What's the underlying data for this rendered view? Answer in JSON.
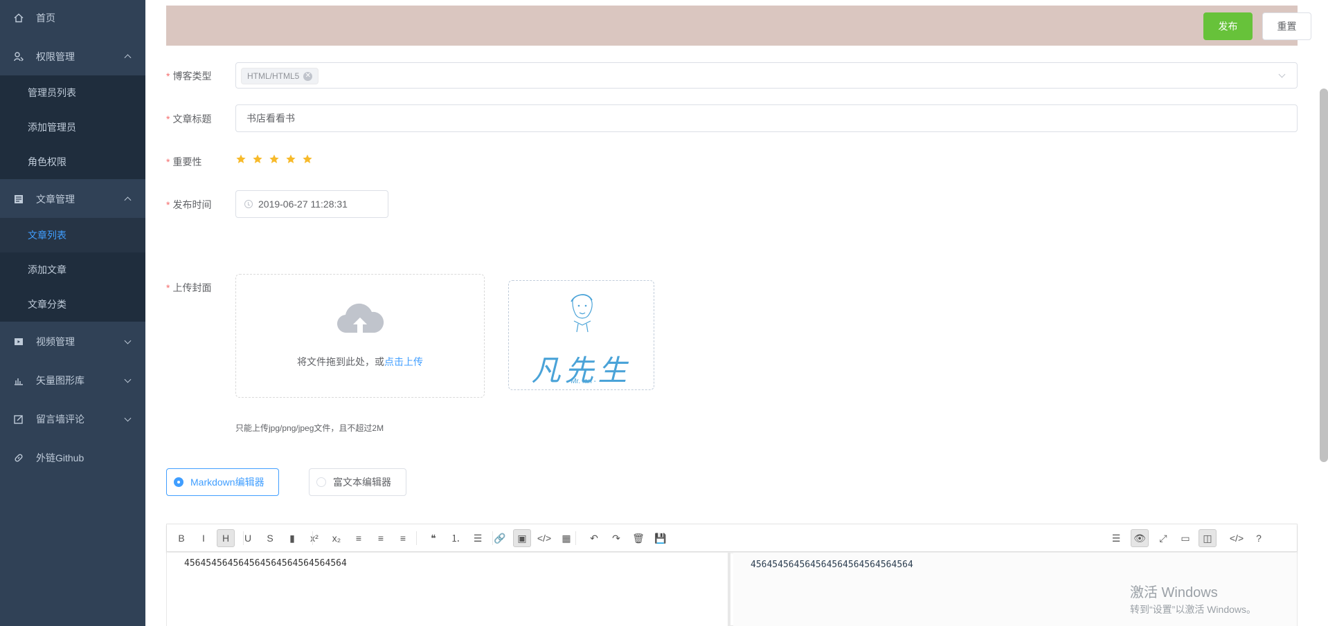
{
  "sidebar": {
    "items": [
      {
        "label": "首页",
        "icon": "home-icon"
      },
      {
        "label": "权限管理",
        "icon": "permission-icon",
        "expanded": true,
        "children": [
          {
            "label": "管理员列表"
          },
          {
            "label": "添加管理员"
          },
          {
            "label": "角色权限"
          }
        ]
      },
      {
        "label": "文章管理",
        "icon": "article-icon",
        "expanded": true,
        "children": [
          {
            "label": "文章列表",
            "active": true
          },
          {
            "label": "添加文章"
          },
          {
            "label": "文章分类"
          }
        ]
      },
      {
        "label": "视频管理",
        "icon": "video-icon",
        "expanded": false
      },
      {
        "label": "矢量图形库",
        "icon": "chart-icon",
        "expanded": false
      },
      {
        "label": "留言墙评论",
        "icon": "edit-icon",
        "expanded": false
      },
      {
        "label": "外链Github",
        "icon": "link-icon"
      }
    ]
  },
  "topbar": {
    "publish_label": "发布",
    "reset_label": "重置"
  },
  "form": {
    "blog_type": {
      "label": "博客类型",
      "tag": "HTML/HTML5"
    },
    "title": {
      "label": "文章标题",
      "value": "书店看看书"
    },
    "importance": {
      "label": "重要性",
      "rating": 5,
      "max": 5
    },
    "publish_time": {
      "label": "发布时间",
      "value": "2019-06-27 11:28:31"
    },
    "cover": {
      "label": "上传封面",
      "drop_text": "将文件拖到此处，或",
      "drop_link": "点击上传",
      "tip": "只能上传jpg/png/jpeg文件，且不超过2M",
      "preview_text": "凡先生",
      "preview_sub": "- Mr. fan -"
    },
    "editor_mode": {
      "markdown": "Markdown编辑器",
      "rich": "富文本编辑器",
      "selected": "markdown"
    }
  },
  "editor": {
    "content": "456454564564564564564564564564",
    "preview": "456454564564564564564564564564",
    "left_tools": [
      {
        "icon": "bold-icon",
        "glyph": "B"
      },
      {
        "icon": "italic-icon",
        "glyph": "I"
      },
      {
        "icon": "heading-icon",
        "glyph": "H",
        "on": true
      },
      {
        "icon": "underline-icon",
        "glyph": "U"
      },
      {
        "icon": "strikethrough-icon",
        "glyph": "S"
      },
      {
        "icon": "bookmark-icon",
        "glyph": "▮"
      },
      {
        "icon": "superscript-icon",
        "glyph": "x²"
      },
      {
        "icon": "subscript-icon",
        "glyph": "x₂"
      },
      {
        "icon": "align-left-icon",
        "glyph": "≡"
      },
      {
        "icon": "align-center-icon",
        "glyph": "≡"
      },
      {
        "icon": "align-right-icon",
        "glyph": "≡"
      },
      {
        "icon": "quote-icon",
        "glyph": "❝"
      },
      {
        "icon": "ordered-list-icon",
        "glyph": "⒈"
      },
      {
        "icon": "unordered-list-icon",
        "glyph": "☰"
      },
      {
        "icon": "link-icon",
        "glyph": "🔗"
      },
      {
        "icon": "image-icon",
        "glyph": "▣",
        "on": true
      },
      {
        "icon": "code-icon",
        "glyph": "</>"
      },
      {
        "icon": "table-icon",
        "glyph": "▦"
      },
      {
        "icon": "undo-icon",
        "glyph": "↶"
      },
      {
        "icon": "redo-icon",
        "glyph": "↷"
      },
      {
        "icon": "trash-icon",
        "glyph": "🗑"
      },
      {
        "icon": "save-icon",
        "glyph": "💾"
      }
    ],
    "right_tools": [
      {
        "icon": "navigation-icon",
        "glyph": "☰"
      },
      {
        "icon": "preview-toggle-icon",
        "glyph": "👁",
        "on": true
      },
      {
        "icon": "fullscreen-icon",
        "glyph": "⤢"
      },
      {
        "icon": "window-icon",
        "glyph": "▭"
      },
      {
        "icon": "split-view-icon",
        "glyph": "◫",
        "on": true
      },
      {
        "icon": "html-code-icon",
        "glyph": "</>"
      },
      {
        "icon": "help-icon",
        "glyph": "?"
      }
    ]
  },
  "watermark": {
    "line1": "激活 Windows",
    "line2": "转到“设置”以激活 Windows。"
  },
  "colors": {
    "sidebar": "#304156",
    "accent": "#409eff",
    "publish": "#67c23a",
    "star": "#f7ba2a",
    "topbar": "#dac6c0"
  }
}
